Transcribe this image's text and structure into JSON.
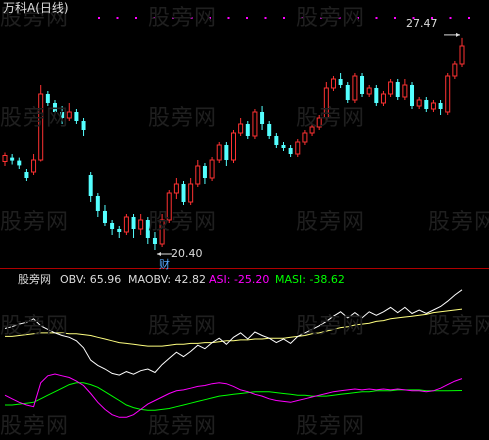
{
  "header": {
    "stock_title": "万科A(日线)"
  },
  "watermark": {
    "text": "股旁网"
  },
  "price_panel": {
    "high_label": "27.47",
    "low_label": "20.40",
    "event_marker": "财",
    "colors": {
      "up": "#ff3232",
      "down": "#54ffff",
      "dots": "#ff00ff"
    }
  },
  "indicator_panel": {
    "name": "股旁网",
    "obv_label": "OBV: 65.96",
    "maobv_label": "MAOBV: 42.82",
    "asi_label": "ASI: -25.20",
    "masi_label": "MASI: -38.62",
    "colors": {
      "obv": "#ffffff",
      "maobv": "#ffff80",
      "asi": "#ff00ff",
      "masi": "#00ff00"
    }
  },
  "chart_data": {
    "type": "candlestick",
    "price_range": [
      20.0,
      28.2
    ],
    "candles": [
      [
        23.35,
        23.55,
        23.2,
        23.65
      ],
      [
        23.48,
        23.38,
        23.25,
        23.6
      ],
      [
        23.38,
        23.22,
        23.1,
        23.48
      ],
      [
        23.0,
        22.8,
        22.7,
        23.1
      ],
      [
        23.0,
        23.4,
        22.9,
        23.6
      ],
      [
        23.4,
        25.6,
        23.35,
        25.9
      ],
      [
        25.6,
        25.3,
        25.2,
        25.7
      ],
      [
        25.3,
        25.0,
        24.9,
        25.4
      ],
      [
        25.0,
        24.8,
        24.6,
        25.2
      ],
      [
        24.8,
        25.0,
        24.7,
        25.3
      ],
      [
        25.0,
        24.7,
        24.6,
        25.1
      ],
      [
        24.7,
        24.4,
        24.2,
        24.8
      ],
      [
        22.9,
        22.2,
        22.0,
        23.0
      ],
      [
        22.2,
        21.7,
        21.5,
        22.3
      ],
      [
        21.7,
        21.3,
        21.2,
        21.9
      ],
      [
        21.3,
        21.1,
        20.9,
        21.4
      ],
      [
        21.1,
        21.0,
        20.8,
        21.2
      ],
      [
        21.0,
        21.5,
        20.9,
        21.6
      ],
      [
        21.5,
        21.1,
        20.8,
        21.6
      ],
      [
        21.1,
        21.4,
        20.9,
        21.6
      ],
      [
        21.4,
        20.8,
        20.6,
        21.5
      ],
      [
        20.8,
        20.6,
        20.4,
        21.0
      ],
      [
        20.6,
        21.4,
        20.5,
        21.6
      ],
      [
        21.4,
        22.3,
        21.3,
        22.4
      ],
      [
        22.3,
        22.6,
        22.1,
        22.8
      ],
      [
        22.6,
        22.0,
        21.9,
        22.7
      ],
      [
        22.0,
        22.6,
        21.9,
        22.8
      ],
      [
        22.6,
        23.2,
        22.5,
        23.4
      ],
      [
        23.2,
        22.8,
        22.6,
        23.3
      ],
      [
        22.8,
        23.4,
        22.7,
        23.5
      ],
      [
        23.4,
        23.9,
        23.3,
        24.0
      ],
      [
        23.9,
        23.4,
        23.2,
        24.0
      ],
      [
        23.4,
        24.3,
        23.3,
        24.4
      ],
      [
        24.3,
        24.6,
        24.2,
        24.8
      ],
      [
        24.6,
        24.2,
        24.1,
        24.7
      ],
      [
        24.2,
        25.0,
        24.1,
        25.1
      ],
      [
        25.0,
        24.6,
        24.4,
        25.2
      ],
      [
        24.6,
        24.2,
        24.1,
        24.7
      ],
      [
        24.2,
        23.9,
        23.8,
        24.3
      ],
      [
        23.9,
        23.8,
        23.7,
        24.0
      ],
      [
        23.8,
        23.6,
        23.5,
        23.9
      ],
      [
        23.6,
        24.0,
        23.5,
        24.1
      ],
      [
        24.0,
        24.3,
        23.9,
        24.4
      ],
      [
        24.3,
        24.5,
        24.2,
        24.6
      ],
      [
        24.5,
        24.8,
        24.4,
        24.9
      ],
      [
        24.8,
        25.8,
        24.7,
        26.0
      ],
      [
        25.8,
        26.1,
        25.7,
        26.2
      ],
      [
        26.1,
        25.9,
        25.8,
        26.3
      ],
      [
        25.9,
        25.4,
        25.3,
        26.0
      ],
      [
        25.4,
        26.2,
        25.3,
        26.3
      ],
      [
        26.2,
        25.6,
        25.5,
        26.3
      ],
      [
        25.6,
        25.8,
        25.5,
        25.9
      ],
      [
        25.8,
        25.3,
        25.2,
        25.9
      ],
      [
        25.3,
        25.6,
        25.2,
        25.7
      ],
      [
        25.6,
        26.0,
        25.5,
        26.1
      ],
      [
        26.0,
        25.5,
        25.4,
        26.1
      ],
      [
        25.5,
        25.9,
        25.4,
        26.1
      ],
      [
        25.9,
        25.2,
        25.1,
        26.0
      ],
      [
        25.2,
        25.4,
        25.1,
        25.5
      ],
      [
        25.4,
        25.1,
        25.0,
        25.5
      ],
      [
        25.1,
        25.3,
        25.0,
        25.4
      ],
      [
        25.3,
        25.1,
        24.9,
        25.4
      ],
      [
        25.0,
        26.2,
        24.9,
        26.3
      ],
      [
        26.2,
        26.6,
        26.1,
        26.7
      ],
      [
        26.6,
        27.2,
        26.5,
        27.47
      ]
    ],
    "obv": [
      74,
      76,
      79,
      81,
      85,
      77,
      73,
      69,
      66,
      64,
      60,
      52,
      38,
      32,
      28,
      23,
      21,
      25,
      22,
      26,
      28,
      24,
      33,
      40,
      47,
      42,
      48,
      55,
      51,
      58,
      63,
      56,
      64,
      69,
      62,
      70,
      66,
      63,
      58,
      62,
      57,
      65,
      69,
      73,
      77,
      82,
      88,
      93,
      86,
      92,
      86,
      93,
      89,
      93,
      98,
      92,
      98,
      91,
      95,
      91,
      95,
      99,
      105,
      112,
      118
    ],
    "maobv": [
      65,
      65,
      66,
      67,
      68,
      69,
      69,
      69,
      69,
      68,
      68,
      67,
      66,
      64,
      62,
      60,
      58,
      57,
      56,
      55,
      54,
      54,
      54,
      55,
      56,
      56,
      57,
      57,
      58,
      58,
      59,
      60,
      60,
      61,
      61,
      62,
      62,
      63,
      63,
      63,
      64,
      65,
      66,
      68,
      69,
      71,
      73,
      75,
      76,
      78,
      79,
      80,
      82,
      83,
      85,
      86,
      87,
      88,
      89,
      90,
      92,
      93,
      94,
      95,
      96
    ],
    "asi": [
      -44,
      -48,
      -52,
      -55,
      -57,
      -30,
      -22,
      -20,
      -22,
      -24,
      -28,
      -33,
      -42,
      -52,
      -60,
      -66,
      -69,
      -69,
      -66,
      -60,
      -54,
      -50,
      -46,
      -42,
      -39,
      -38,
      -36,
      -34,
      -33,
      -31,
      -30,
      -31,
      -34,
      -38,
      -40,
      -43,
      -45,
      -48,
      -50,
      -51,
      -52,
      -50,
      -48,
      -46,
      -44,
      -42,
      -40,
      -39,
      -38,
      -37,
      -38,
      -37,
      -38,
      -37,
      -38,
      -37,
      -38,
      -39,
      -39,
      -40,
      -39,
      -36,
      -32,
      -28,
      -25.2
    ],
    "masi": [
      -55,
      -55,
      -54,
      -53,
      -52,
      -48,
      -44,
      -40,
      -36,
      -32,
      -30,
      -30,
      -32,
      -35,
      -40,
      -45,
      -50,
      -55,
      -58,
      -60,
      -61,
      -61,
      -60,
      -59,
      -57,
      -55,
      -53,
      -51,
      -49,
      -47,
      -45,
      -44,
      -43,
      -42,
      -41,
      -40,
      -40,
      -40,
      -41,
      -42,
      -43,
      -44,
      -44,
      -45,
      -45,
      -45,
      -44,
      -43,
      -42,
      -41,
      -40,
      -40,
      -39,
      -39,
      -39,
      -38,
      -38,
      -38,
      -38,
      -39,
      -39,
      -39,
      -39,
      -38.8,
      -38.62
    ]
  }
}
